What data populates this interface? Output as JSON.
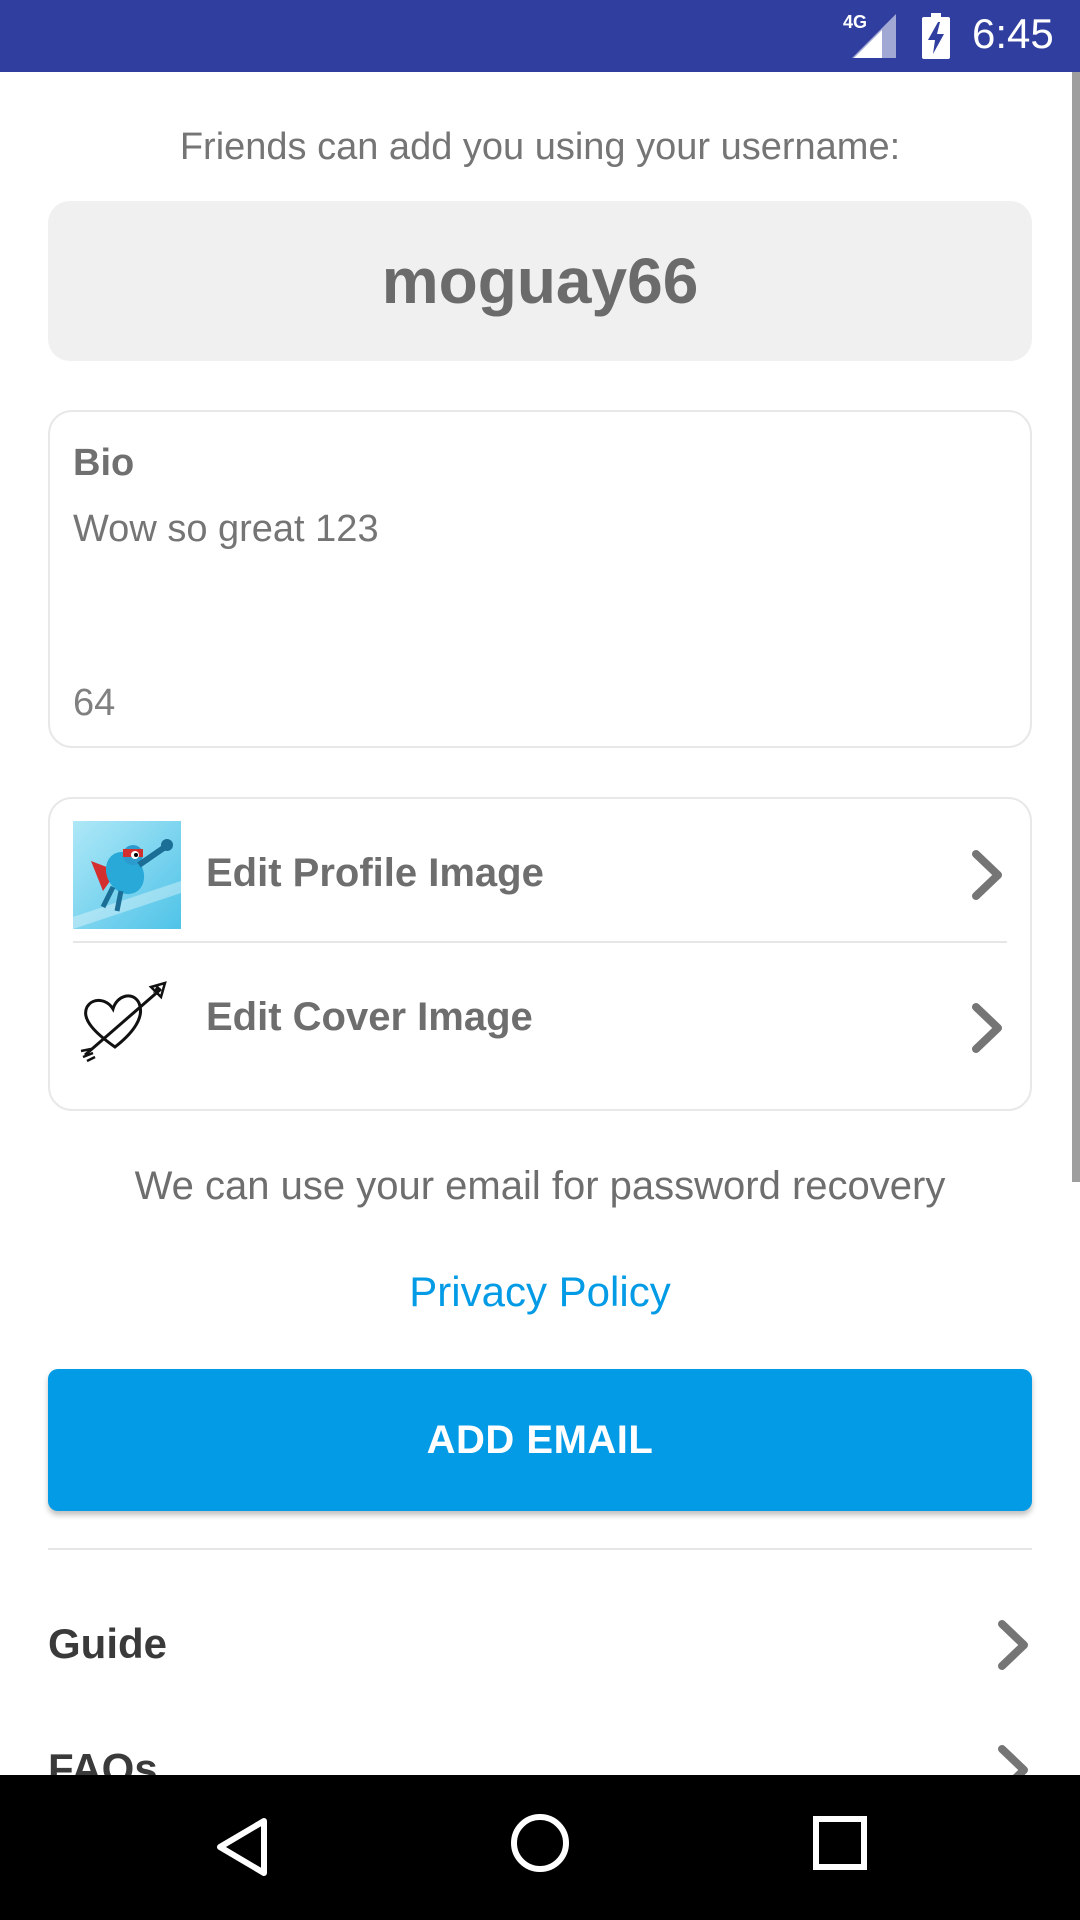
{
  "status_bar": {
    "network": "4G",
    "time": "6:45",
    "signal_icon": "cell-signal-icon",
    "battery_icon": "battery-charging-icon",
    "color": "#303f9f"
  },
  "profile": {
    "intro_text": "Friends can add you using your username:",
    "username": "moguay66"
  },
  "bio": {
    "label": "Bio",
    "text": "Wow so great 123",
    "remaining_chars": "64"
  },
  "edit_images": {
    "profile_label": "Edit Profile Image",
    "cover_label": "Edit Cover Image"
  },
  "email": {
    "note": "We can use your email for password recovery",
    "privacy_link": "Privacy Policy",
    "add_button": "ADD EMAIL",
    "accent_color": "#039be5"
  },
  "menu": {
    "items": [
      {
        "label": "Guide"
      },
      {
        "label": "FAQs"
      }
    ]
  },
  "nav_bar": {
    "back_icon": "back-triangle-icon",
    "home_icon": "home-circle-icon",
    "recents_icon": "recents-square-icon"
  }
}
